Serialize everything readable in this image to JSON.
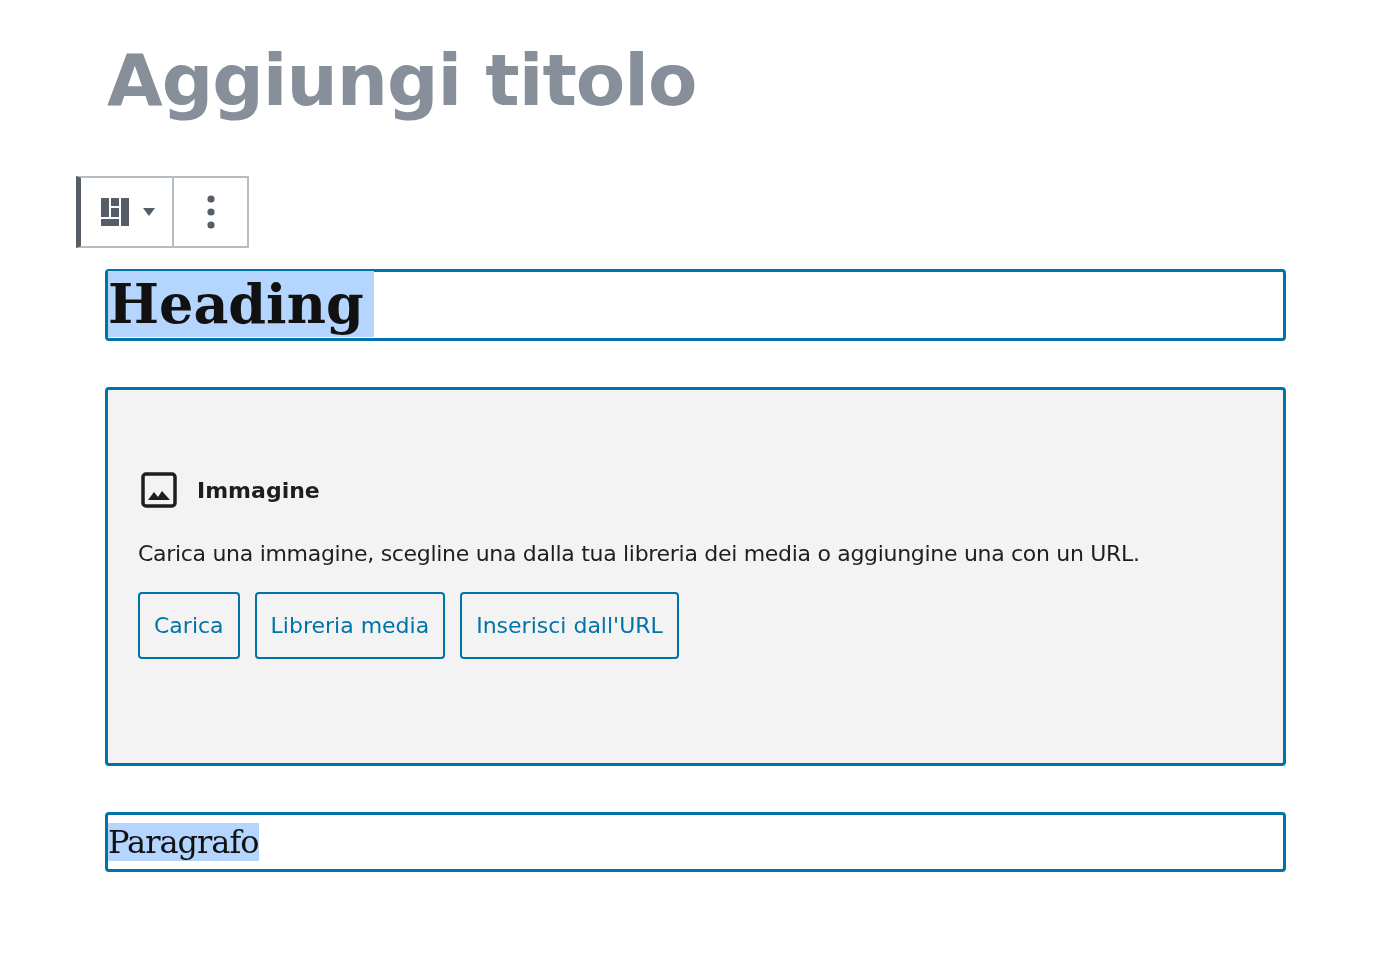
{
  "title": {
    "placeholder": "Aggiungi titolo"
  },
  "block_toolbar": {
    "buttons": [
      {
        "kind": "block-type"
      },
      {
        "kind": "more-options"
      }
    ]
  },
  "blocks": [
    {
      "kind": "heading",
      "text": "Heading",
      "highlighted": true
    },
    {
      "kind": "image",
      "label": "Immagine",
      "instructions": "Carica una immagine, scegline una dalla tua libreria dei media o aggiungine una con un URL.",
      "buttons": [
        "Carica",
        "Libreria media",
        "Inserisci dall'URL"
      ]
    },
    {
      "kind": "paragraph",
      "text": "Paragrafo",
      "highlighted": true
    }
  ]
}
